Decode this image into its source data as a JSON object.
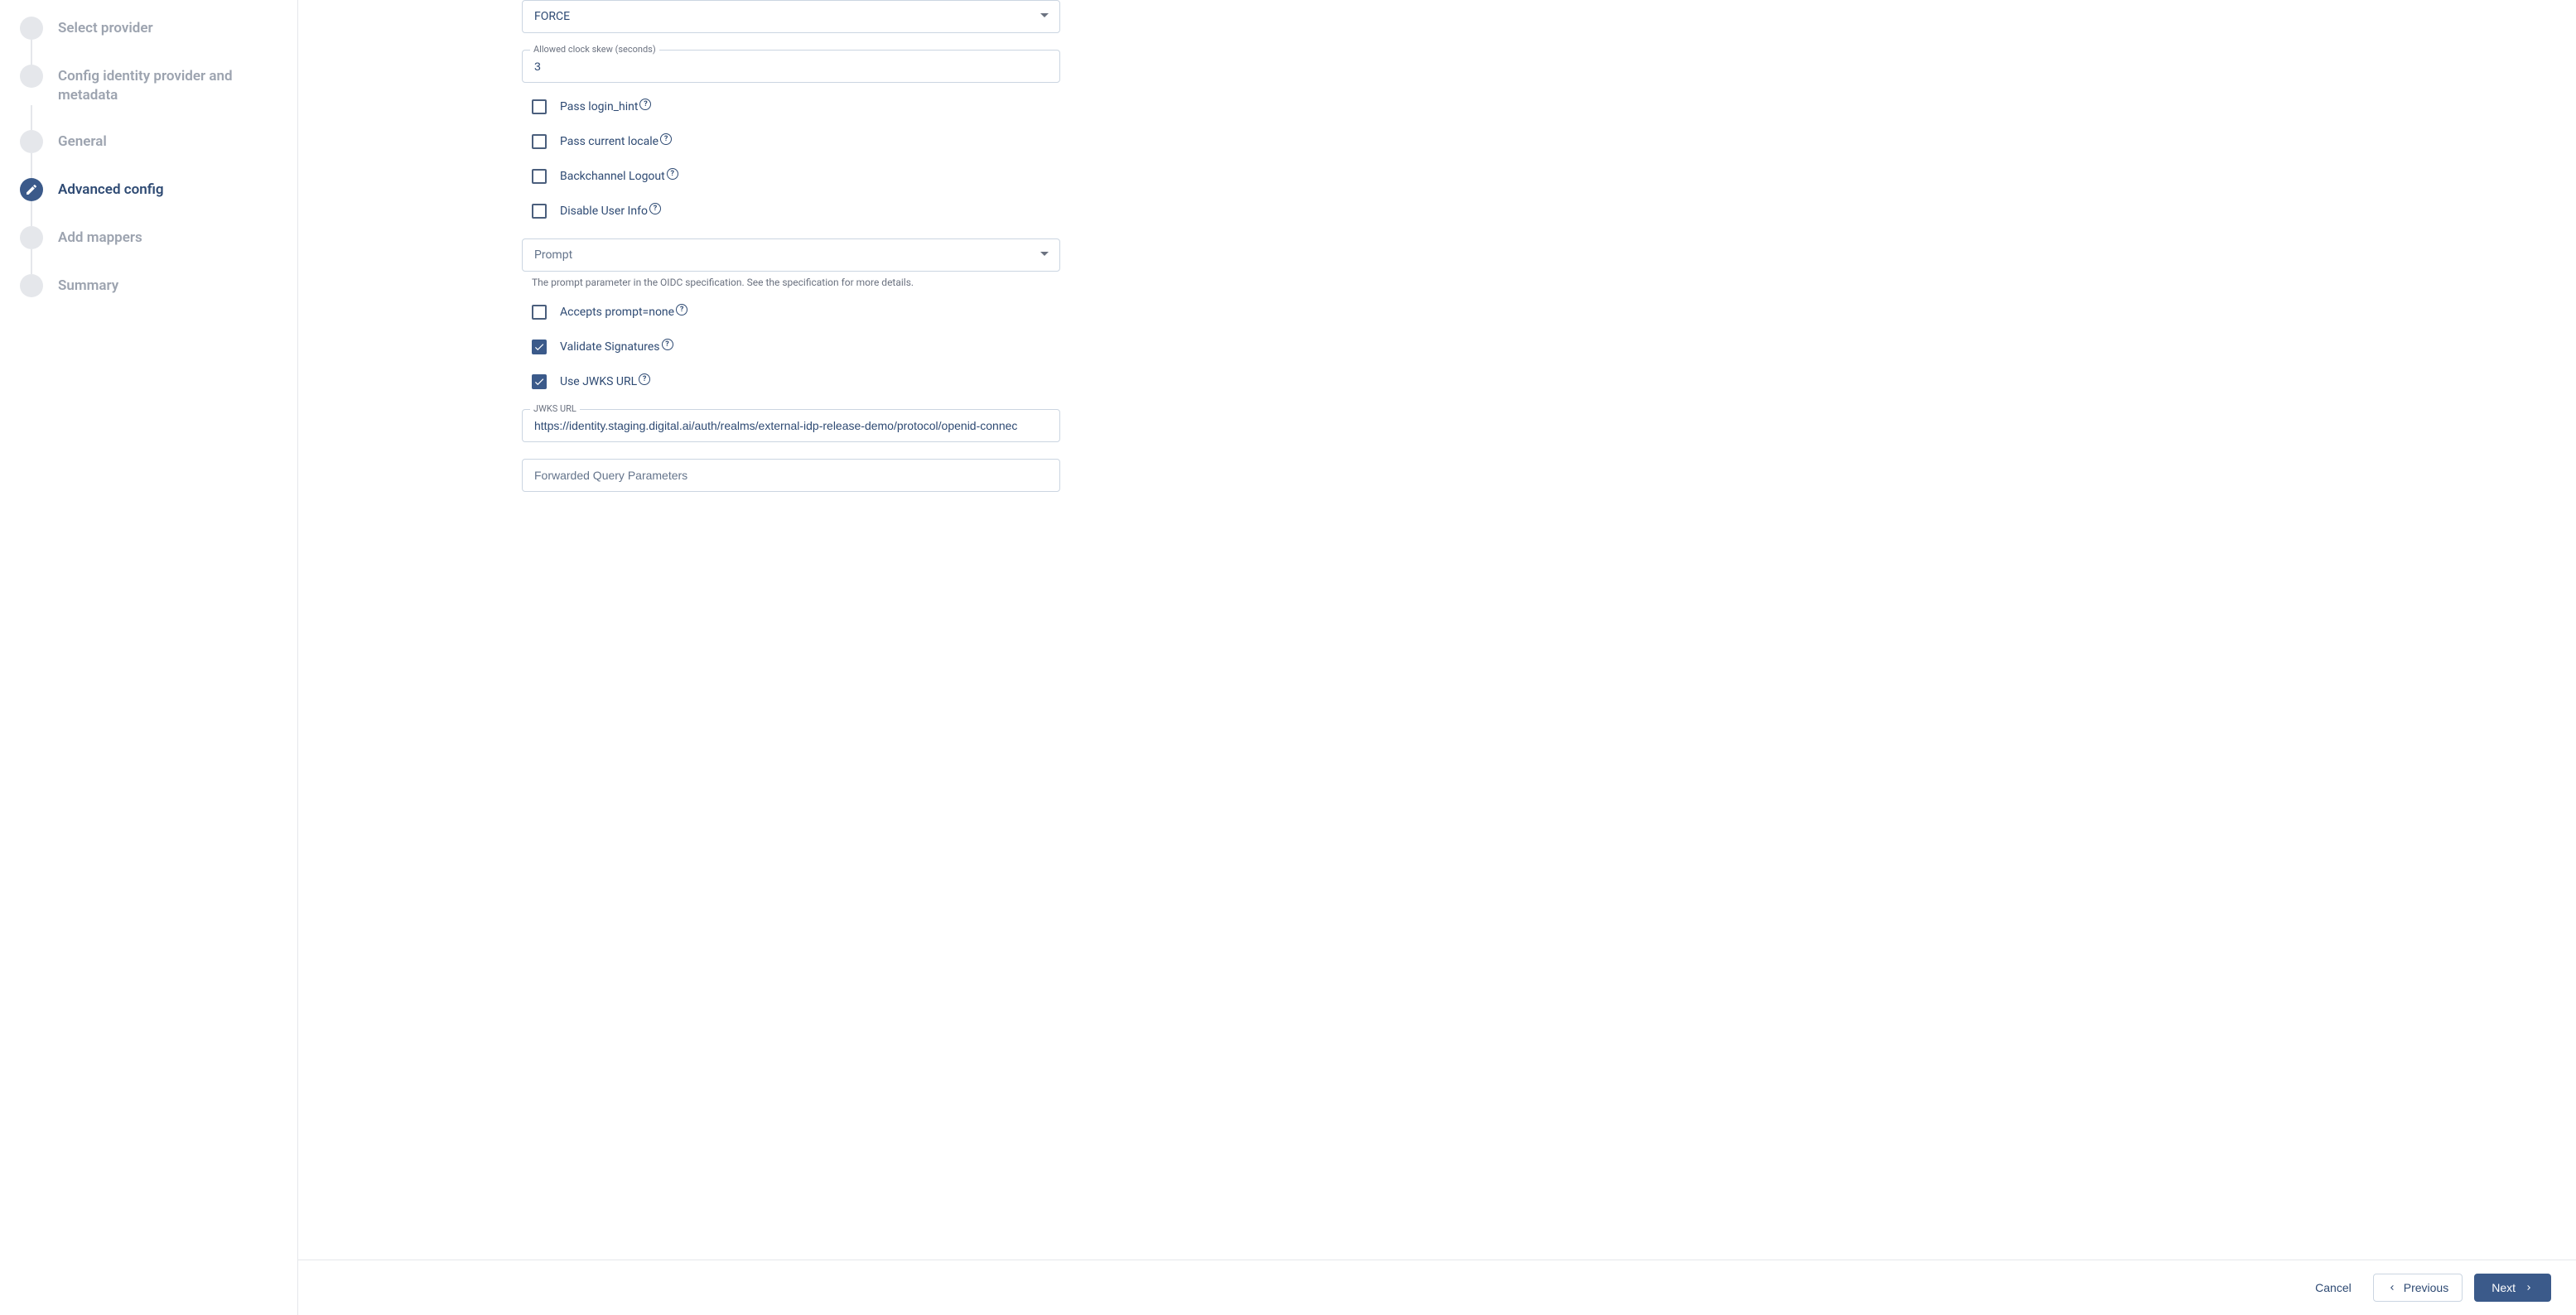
{
  "sidebar": {
    "steps": [
      {
        "label": "Select provider",
        "active": false
      },
      {
        "label": "Config identity provider and metadata",
        "active": false
      },
      {
        "label": "General",
        "active": false
      },
      {
        "label": "Advanced config",
        "active": true
      },
      {
        "label": "Add mappers",
        "active": false
      },
      {
        "label": "Summary",
        "active": false
      }
    ]
  },
  "form": {
    "force_select": {
      "value": "FORCE"
    },
    "clock_skew": {
      "label": "Allowed clock skew (seconds)",
      "value": "3"
    },
    "pass_login_hint": {
      "label": "Pass login_hint",
      "checked": false
    },
    "pass_current_locale": {
      "label": "Pass current locale",
      "checked": false
    },
    "backchannel_logout": {
      "label": "Backchannel Logout",
      "checked": false
    },
    "disable_user_info": {
      "label": "Disable User Info",
      "checked": false
    },
    "prompt_select": {
      "placeholder": "Prompt",
      "helper": "The prompt parameter in the OIDC specification. See the specification for more details."
    },
    "accepts_prompt_none": {
      "label": "Accepts prompt=none",
      "checked": false
    },
    "validate_signatures": {
      "label": "Validate Signatures",
      "checked": true
    },
    "use_jwks_url": {
      "label": "Use JWKS URL",
      "checked": true
    },
    "jwks_url": {
      "label": "JWKS URL",
      "value": "https://identity.staging.digital.ai/auth/realms/external-idp-release-demo/protocol/openid-connec"
    },
    "forwarded_query": {
      "placeholder": "Forwarded Query Parameters"
    }
  },
  "footer": {
    "cancel": "Cancel",
    "previous": "Previous",
    "next": "Next"
  }
}
